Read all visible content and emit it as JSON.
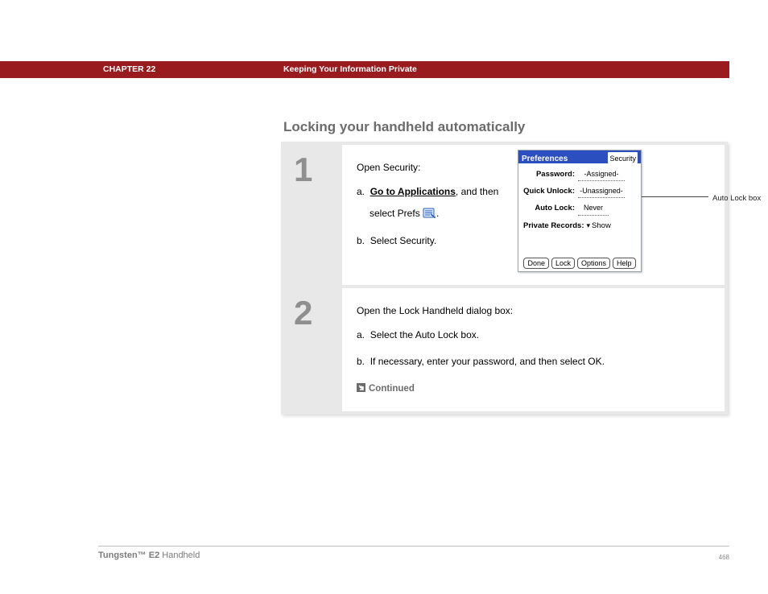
{
  "header": {
    "chapter": "CHAPTER 22",
    "title": "Keeping Your Information Private"
  },
  "section_heading": "Locking your handheld automatically",
  "steps": [
    {
      "num": "1",
      "intro": "Open Security:",
      "a_prefix": "a.",
      "a_link": "Go to Applications",
      "a_mid": ", and then",
      "a_line2_pre": "select Prefs ",
      "a_line2_post": ".",
      "b_prefix": "b.",
      "b_text": "Select Security."
    },
    {
      "num": "2",
      "intro": "Open the Lock Handheld dialog box:",
      "a_prefix": "a.",
      "a_text": "Select the Auto Lock box.",
      "b_prefix": "b.",
      "b_text": "If necessary, enter your password, and then select OK."
    }
  ],
  "continued": "Continued",
  "palm": {
    "title_left": "Preferences",
    "title_right": "Security",
    "rows": {
      "password_label": "Password:",
      "password_val": "-Assigned-",
      "quick_label": "Quick Unlock:",
      "quick_val": "-Unassigned-",
      "auto_label": "Auto Lock:",
      "auto_val": "Never"
    },
    "private_label": "Private Records:",
    "private_val": "Show",
    "buttons": [
      "Done",
      "Lock",
      "Options",
      "Help"
    ]
  },
  "callout": "Auto Lock box",
  "footer": {
    "product_bold": "Tungsten™ E2",
    "product_rest": " Handheld",
    "page": "468"
  }
}
